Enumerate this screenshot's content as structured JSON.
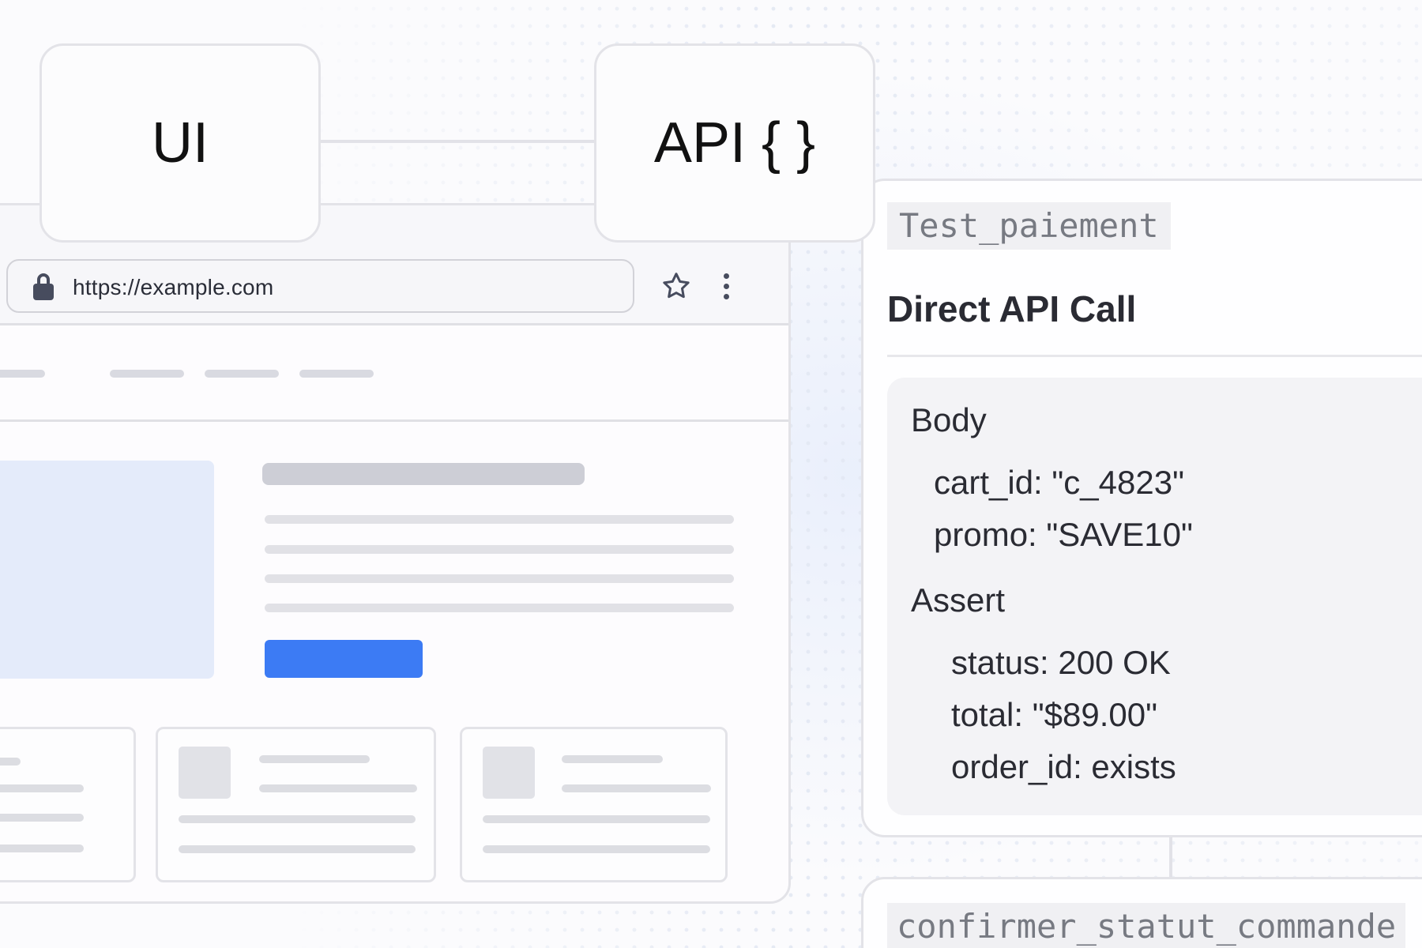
{
  "labels": {
    "ui": "UI",
    "api": "API { }"
  },
  "browser": {
    "url": "https://example.com"
  },
  "api_panel": {
    "test_name": "Test_paiement",
    "title": "Direct API Call",
    "body_heading": "Body",
    "body": [
      "cart_id: \"c_4823\"",
      "promo: \"SAVE10\""
    ],
    "assert_heading": "Assert",
    "assertions": [
      "status: 200 OK",
      "total: \"$89.00\"",
      "order_id: exists"
    ]
  },
  "next_panel": {
    "test_name": "confirmer_statut_commande"
  },
  "colors": {
    "accent": "#3c7bf4",
    "hero": "#e4ebfa",
    "border": "#e3e3e8"
  }
}
